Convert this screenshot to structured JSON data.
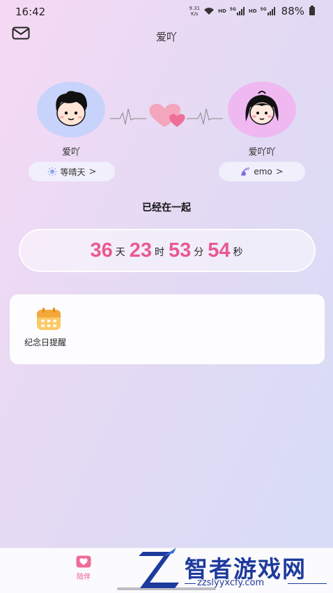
{
  "status_bar": {
    "time": "16:42",
    "net_speed_value": "9.31",
    "net_speed_unit": "K/s",
    "hd1": "HD",
    "hd2": "HD",
    "network1": "5G",
    "network2": "5G",
    "battery": "88%"
  },
  "header": {
    "title": "爱吖"
  },
  "couple": {
    "left": {
      "name": "爱吖",
      "mood_label": "等晴天",
      "mood_icon": "sun-icon"
    },
    "right": {
      "name": "爱吖吖",
      "mood_label": "emo",
      "mood_icon": "emo-icon"
    }
  },
  "together": {
    "title": "已经在一起",
    "days": "36",
    "days_unit": "天",
    "hours": "23",
    "hours_unit": "时",
    "minutes": "53",
    "minutes_unit": "分",
    "seconds": "54",
    "seconds_unit": "秒"
  },
  "card": {
    "label": "纪念日提醒"
  },
  "tabbar": {
    "tab1_label": "陪伴"
  },
  "watermark": {
    "text": "智者游戏网",
    "url": "zzslyyxcfy.com"
  },
  "colors": {
    "accent_pink": "#e95a8e",
    "watermark_blue": "#1d3a9c"
  }
}
